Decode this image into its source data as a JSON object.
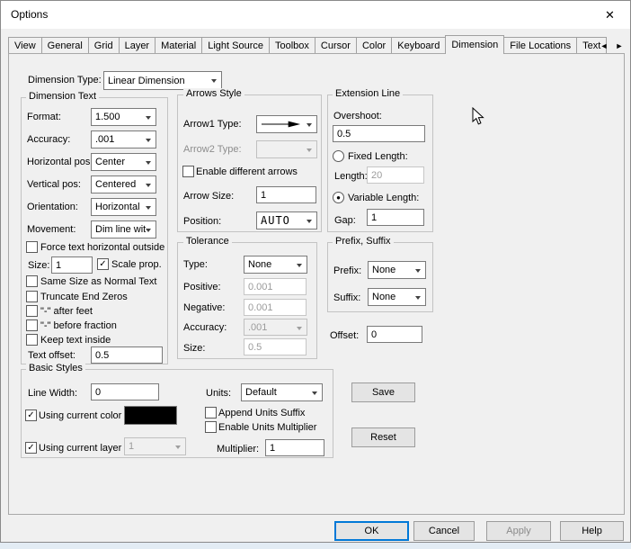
{
  "window": {
    "title": "Options",
    "close_glyph": "✕"
  },
  "tabs": {
    "items": [
      "View",
      "General",
      "Grid",
      "Layer",
      "Material",
      "Light Source",
      "Toolbox",
      "Cursor",
      "Color",
      "Keyboard",
      "Dimension",
      "File Locations",
      "Text"
    ],
    "active": "Dimension",
    "scroll_left_glyph": "◄",
    "scroll_right_glyph": "►"
  },
  "dimension_type": {
    "label": "Dimension Type:",
    "value": "Linear Dimension"
  },
  "dimension_text": {
    "title": "Dimension Text",
    "format": {
      "label": "Format:",
      "value": "1.500"
    },
    "accuracy": {
      "label": "Accuracy:",
      "value": ".001"
    },
    "horizontal_pos": {
      "label": "Horizontal pos:",
      "value": "Center"
    },
    "vertical_pos": {
      "label": "Vertical pos:",
      "value": "Centered"
    },
    "orientation": {
      "label": "Orientation:",
      "value": "Horizontal"
    },
    "movement": {
      "label": "Movement:",
      "value": "Dim line wit"
    },
    "force_text": {
      "label": "Force text horizontal outside",
      "mark": ""
    },
    "size": {
      "label": "Size:",
      "value": "1"
    },
    "scale_prop": {
      "label": "Scale prop.",
      "mark": "✓"
    },
    "same_size": {
      "label": "Same Size as Normal Text",
      "mark": ""
    },
    "truncate": {
      "label": "Truncate End Zeros",
      "mark": ""
    },
    "after_feet": {
      "label": "\"-\" after feet",
      "mark": ""
    },
    "before_fraction": {
      "label": "\"-\" before fraction",
      "mark": ""
    },
    "keep_inside": {
      "label": "Keep text inside",
      "mark": ""
    },
    "text_offset": {
      "label": "Text offset:",
      "value": "0.5"
    }
  },
  "arrows_style": {
    "title": "Arrows Style",
    "arrow1": {
      "label": "Arrow1 Type:"
    },
    "arrow2": {
      "label": "Arrow2 Type:"
    },
    "enable_different": {
      "label": "Enable different arrows",
      "mark": ""
    },
    "arrow_size": {
      "label": "Arrow Size:",
      "value": "1"
    },
    "position": {
      "label": "Position:",
      "value": "AUTO"
    }
  },
  "tolerance": {
    "title": "Tolerance",
    "type": {
      "label": "Type:",
      "value": "None"
    },
    "positive": {
      "label": "Positive:",
      "value": "0.001"
    },
    "negative": {
      "label": "Negative:",
      "value": "0.001"
    },
    "accuracy": {
      "label": "Accuracy:",
      "value": ".001"
    },
    "size": {
      "label": "Size:",
      "value": "0.5"
    }
  },
  "extension_line": {
    "title": "Extension Line",
    "overshoot": {
      "label": "Overshoot:",
      "value": "0.5"
    },
    "fixed_length": {
      "label": "Fixed Length:",
      "mark": ""
    },
    "length": {
      "label": "Length:",
      "value": "20"
    },
    "variable_length": {
      "label": "Variable Length:",
      "mark": "●"
    },
    "gap": {
      "label": "Gap:",
      "value": "1"
    }
  },
  "prefix_suffix": {
    "title": "Prefix, Suffix",
    "prefix": {
      "label": "Prefix:",
      "value": "None"
    },
    "suffix": {
      "label": "Suffix:",
      "value": "None"
    }
  },
  "offset": {
    "label": "Offset:",
    "value": "0"
  },
  "basic_styles": {
    "title": "Basic Styles",
    "line_width": {
      "label": "Line Width:",
      "value": "0"
    },
    "units": {
      "label": "Units:",
      "value": "Default"
    },
    "using_current_color": {
      "label": "Using current color",
      "mark": "✓"
    },
    "swatch_color": "#000000",
    "append_units_suffix": {
      "label": "Append Units Suffix",
      "mark": ""
    },
    "enable_units_multiplier": {
      "label": "Enable Units Multiplier",
      "mark": ""
    },
    "using_current_layer": {
      "label": "Using current layer",
      "mark": "✓"
    },
    "layer_value": "1",
    "multiplier": {
      "label": "Multiplier:",
      "value": "1"
    }
  },
  "buttons": {
    "save": "Save",
    "reset": "Reset",
    "ok": "OK",
    "cancel": "Cancel",
    "apply": "Apply",
    "help": "Help"
  }
}
